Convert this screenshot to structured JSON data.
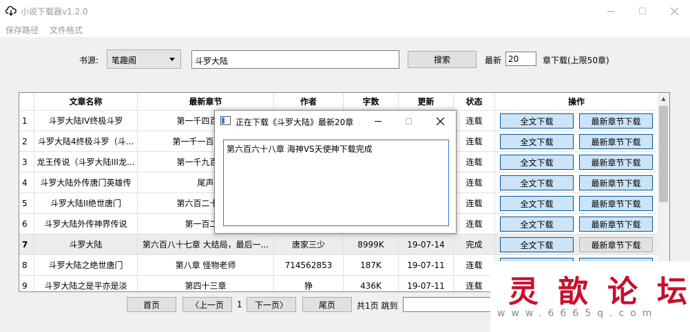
{
  "window": {
    "title": "小说下载器v1.2.0"
  },
  "menu": [
    "保存路径",
    "文件格式"
  ],
  "search": {
    "source_label": "书源:",
    "source_value": "笔趣阁",
    "query": "斗罗大陆",
    "search_label": "搜索",
    "latest_label": "最新",
    "latest_count": "20",
    "chapters_label": "章下载(上限50章)"
  },
  "table": {
    "columns": [
      "文章名称",
      "最新章节",
      "作者",
      "字数",
      "更新",
      "状态",
      "操作"
    ],
    "full_download": "全文下载",
    "latest_download": "最新章节下载",
    "rows": [
      {
        "no": "1",
        "name": "斗罗大陆IV终极斗罗",
        "chapter": "第一千四百零三",
        "author": "",
        "words": "",
        "updated": "",
        "status": "连载"
      },
      {
        "no": "2",
        "name": "斗罗大陆4终极斗罗（斗...",
        "chapter": "第一千一百零六章",
        "author": "",
        "words": "",
        "updated": "",
        "status": "连载"
      },
      {
        "no": "3",
        "name": "龙王传说（斗罗大陆III龙...",
        "chapter": "第一千九百八十",
        "author": "",
        "words": "",
        "updated": "",
        "status": "连载"
      },
      {
        "no": "4",
        "name": "斗罗大陆外传唐门英雄传",
        "chapter": "尾声",
        "author": "",
        "words": "",
        "updated": "",
        "status": "连载"
      },
      {
        "no": "5",
        "name": "斗罗大陆II绝世唐门",
        "chapter": "第六百二十二章",
        "author": "",
        "words": "",
        "updated": "",
        "status": "连载"
      },
      {
        "no": "6",
        "name": "斗罗大陆外传神界传说",
        "chapter": "第一百二十",
        "author": "",
        "words": "",
        "updated": "",
        "status": "连载"
      },
      {
        "no": "7",
        "name": "斗罗大陆",
        "chapter": "第六百八十七章 大结局，最后一...",
        "author": "唐家三少",
        "words": "8999K",
        "updated": "19-07-14",
        "status": "完成"
      },
      {
        "no": "8",
        "name": "斗罗大陆之绝世唐门",
        "chapter": "第八章 怪物老师",
        "author": "714562853",
        "words": "187K",
        "updated": "19-07-11",
        "status": "连载"
      },
      {
        "no": "9",
        "name": "斗罗大陆之是平亦是淡",
        "chapter": "第四十三章",
        "author": "狰",
        "words": "436K",
        "updated": "19-07-11",
        "status": "连载"
      }
    ]
  },
  "pagination": {
    "first": "首页",
    "prev": "〈上一页",
    "current": "1",
    "next": "下一页〉",
    "last": "尾页",
    "total": "共1页 跳到"
  },
  "dialog": {
    "title": "正在下载《斗罗大陆》最新20章",
    "message": "第六百六十八章 海神VS天使神下载完成"
  },
  "watermark": {
    "title": "灵歆论坛",
    "url": "www.6665q.com"
  }
}
